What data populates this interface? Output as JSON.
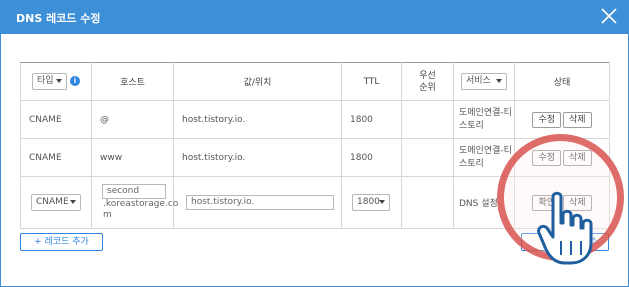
{
  "dialog": {
    "title": "DNS 레코드 수정"
  },
  "table": {
    "headers": {
      "type": "타입",
      "host": "호스트",
      "value": "값/위치",
      "ttl": "TTL",
      "priority_line1": "우선",
      "priority_line2": "순위",
      "service": "서비스",
      "status": "상태"
    },
    "rows": [
      {
        "type": "CNAME",
        "host": "@",
        "value": "host.tistory.io.",
        "ttl": "1800",
        "service_line1": "도메인연결-티",
        "service_line2": "스토리",
        "btn_edit": "수정",
        "btn_delete": "삭제"
      },
      {
        "type": "CNAME",
        "host": "www",
        "value": "host.tistory.io.",
        "ttl": "1800",
        "service_line1": "도메인연결-티",
        "service_line2": "스토리",
        "btn_edit": "수정",
        "btn_delete": "삭제"
      }
    ],
    "edit_row": {
      "type": "CNAME",
      "host_line1": "second",
      "host_line2": ".koreastorage.co",
      "host_line3": "m",
      "value": "host.tistory.io.",
      "ttl": "1800",
      "service": "DNS 설정",
      "btn_confirm": "확인",
      "btn_delete": "삭제"
    }
  },
  "footer": {
    "add_record": "+ 레코드 추가",
    "cancel": "취소"
  },
  "colors": {
    "accent": "#3d8fd8",
    "highlight": "#d9534f"
  }
}
